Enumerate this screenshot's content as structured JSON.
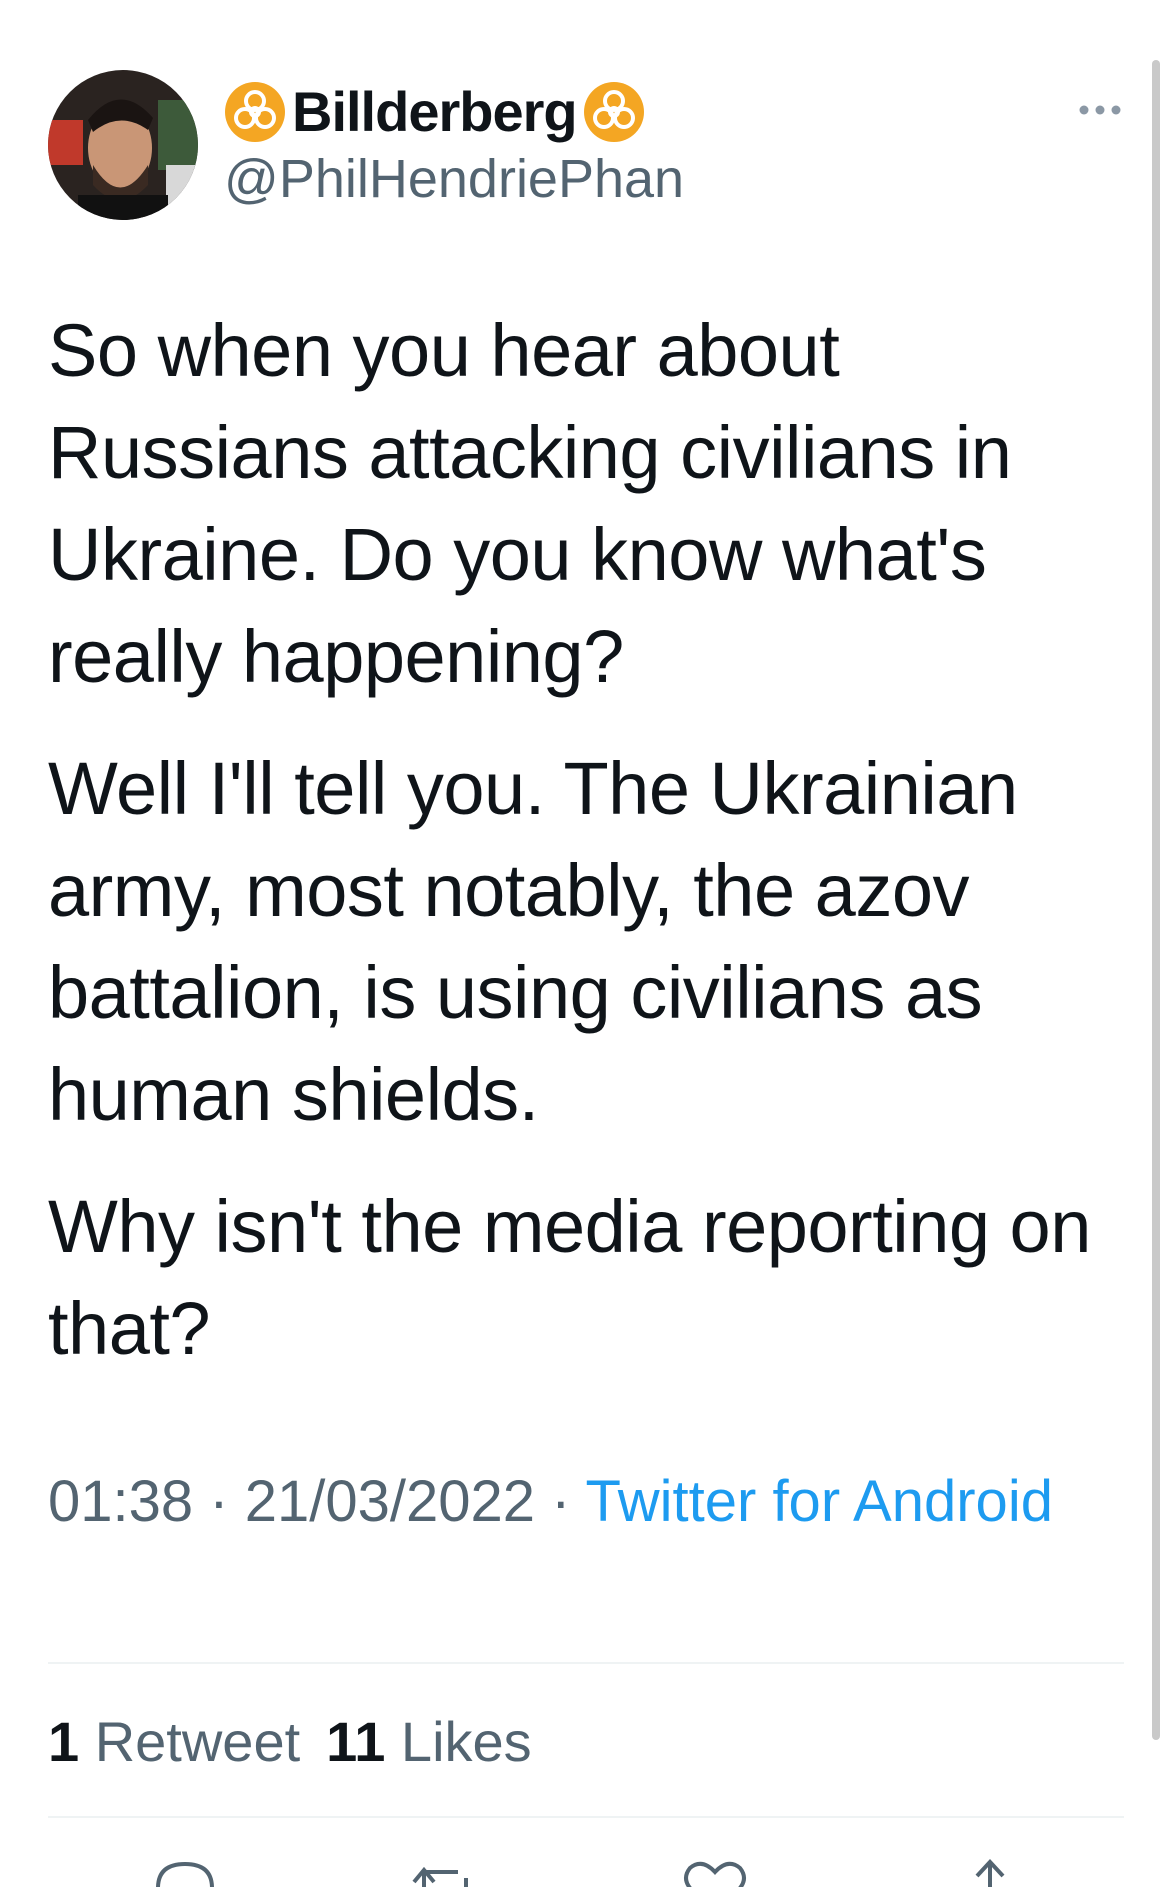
{
  "header": {
    "display_name": "Billderberg",
    "handle": "@PhilHendriePhan",
    "name_emoji": "biohazard-icon",
    "more_icon": "more-dots-icon"
  },
  "tweet": {
    "paragraphs": [
      "So when you hear about Russians attacking civilians in Ukraine. Do you know what's really happening?",
      "Well I'll tell you. The Ukrainian army, most notably, the azov battalion, is using civilians as human shields.",
      "Why isn't the media reporting on that?"
    ],
    "time": "01:38",
    "date": "21/03/2022",
    "separator": "·",
    "source": "Twitter for Android"
  },
  "stats": {
    "retweets_count": "1",
    "retweets_label": "Retweet",
    "likes_count": "11",
    "likes_label": "Likes"
  },
  "actions": [
    "reply-icon",
    "retweet-icon",
    "like-icon",
    "share-icon"
  ],
  "colors": {
    "text": "#0f1419",
    "secondary": "#536471",
    "link": "#1d9bf0",
    "biohazard": "#f4a623",
    "divider": "#eff3f4"
  }
}
